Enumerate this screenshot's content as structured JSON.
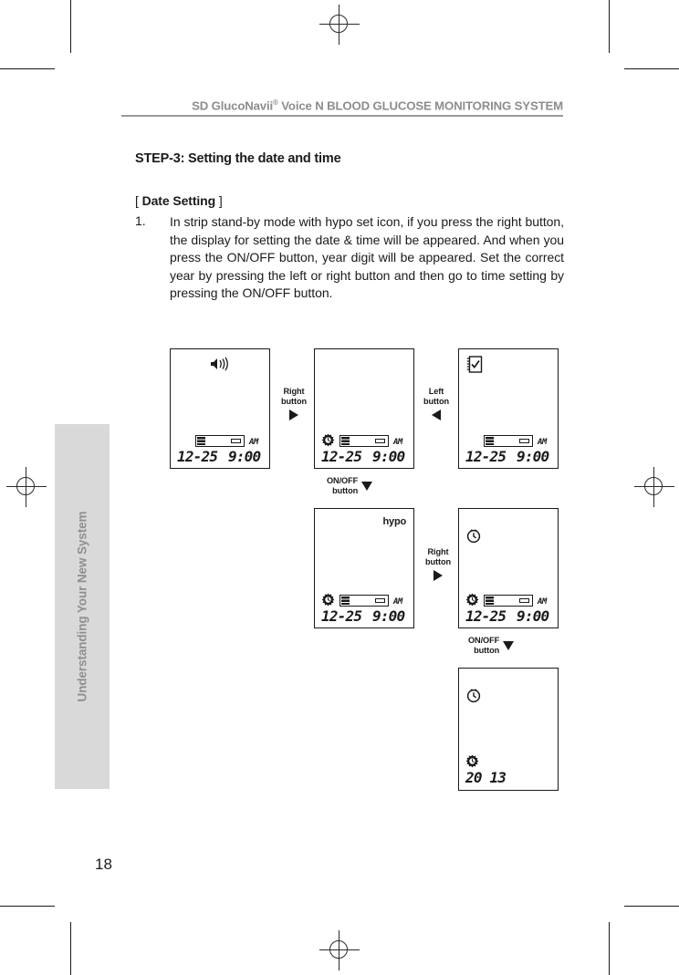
{
  "header": {
    "title_prefix": "SD GlucoNavii",
    "registered_mark": "®",
    "title_suffix": " Voice N BLOOD GLUCOSE MONITORING SYSTEM"
  },
  "step": {
    "heading": "STEP-3: Setting the date and time"
  },
  "section": {
    "bracket_open": "[ ",
    "label": "Date Setting",
    "bracket_close": " ]"
  },
  "paragraph": {
    "number": "1.",
    "text": "In strip stand-by mode with hypo set icon, if you press the right button, the display  for setting the date & time will be appeared. And when you press the ON/OFF button, year digit will be appeared. Set the correct year by pressing the left or right button and then go to time setting by pressing the ON/OFF button."
  },
  "sidebar": {
    "label": "Understanding Your New System",
    "color": "#d9d9d9",
    "text_color": "#8f8f8f"
  },
  "footer": {
    "page_number": "18"
  },
  "annotations": [
    {
      "line1": "Right",
      "line2": "button",
      "direction": "right"
    },
    {
      "line1": "Left",
      "line2": "button",
      "direction": "left"
    },
    {
      "line1": "ON/OFF",
      "line2": "button",
      "direction": "down"
    },
    {
      "line1": "Right",
      "line2": "button",
      "direction": "right"
    },
    {
      "line1": "ON/OFF",
      "line2": "button",
      "direction": "down"
    }
  ],
  "screens": [
    {
      "id": "screen-standby-voice",
      "icons": [
        "speaker-icon",
        "strip-icon"
      ],
      "date": "12-25",
      "time": "9:00",
      "ampm": "AM",
      "year": null,
      "hypo_label": null
    },
    {
      "id": "screen-date-time-setting",
      "icons": [
        "gear-icon",
        "strip-icon"
      ],
      "date": "12-25",
      "time": "9:00",
      "ampm": "AM",
      "year": null,
      "hypo_label": null
    },
    {
      "id": "screen-memo",
      "icons": [
        "memo-icon",
        "strip-icon"
      ],
      "date": "12-25",
      "time": "9:00",
      "ampm": "AM",
      "year": null,
      "hypo_label": null
    },
    {
      "id": "screen-hypo-set",
      "icons": [
        "gear-icon",
        "strip-icon"
      ],
      "date": "12-25",
      "time": "9:00",
      "ampm": "AM",
      "year": null,
      "hypo_label": "hypo"
    },
    {
      "id": "screen-clock-set",
      "icons": [
        "clock-icon",
        "gear-icon",
        "strip-icon"
      ],
      "date": "12-25",
      "time": "9:00",
      "ampm": "AM",
      "year": null,
      "hypo_label": null
    },
    {
      "id": "screen-year-setting",
      "icons": [
        "clock-icon",
        "gear-icon"
      ],
      "date": null,
      "time": null,
      "ampm": null,
      "year": "20 13",
      "hypo_label": null
    }
  ]
}
